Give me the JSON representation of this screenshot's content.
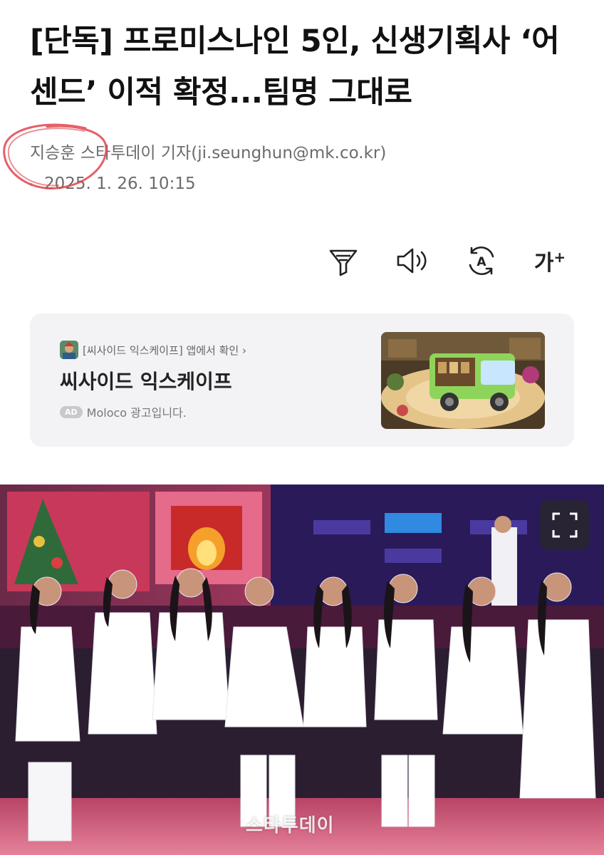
{
  "article": {
    "headline": "[단독] 프로미스나인 5인, 신생기획사 ‘어센드’ 이적 확정...팀명 그대로",
    "byline": "지승훈 스타투데이 기자(ji.seunghun@mk.co.kr)",
    "date": "2025. 1. 26. 10:15"
  },
  "toolbar": {
    "icons": [
      "filter-icon",
      "speaker-icon",
      "translate-icon",
      "font-size-icon"
    ],
    "font_label": "가",
    "font_plus": "+",
    "translate_letter": "A"
  },
  "ad": {
    "app_link": "[씨사이드 익스케이프] 앱에서 확인 ›",
    "title": "씨사이드 익스케이프",
    "badge": "AD",
    "sponsor": "Moloco 광고입니다."
  },
  "photo": {
    "watermark": "스타투데이",
    "expand_icon": "expand-icon"
  },
  "colors": {
    "annotation_circle": "#e0444e",
    "ad_card_bg": "#f3f3f5",
    "text_muted": "#6b6b6b"
  }
}
